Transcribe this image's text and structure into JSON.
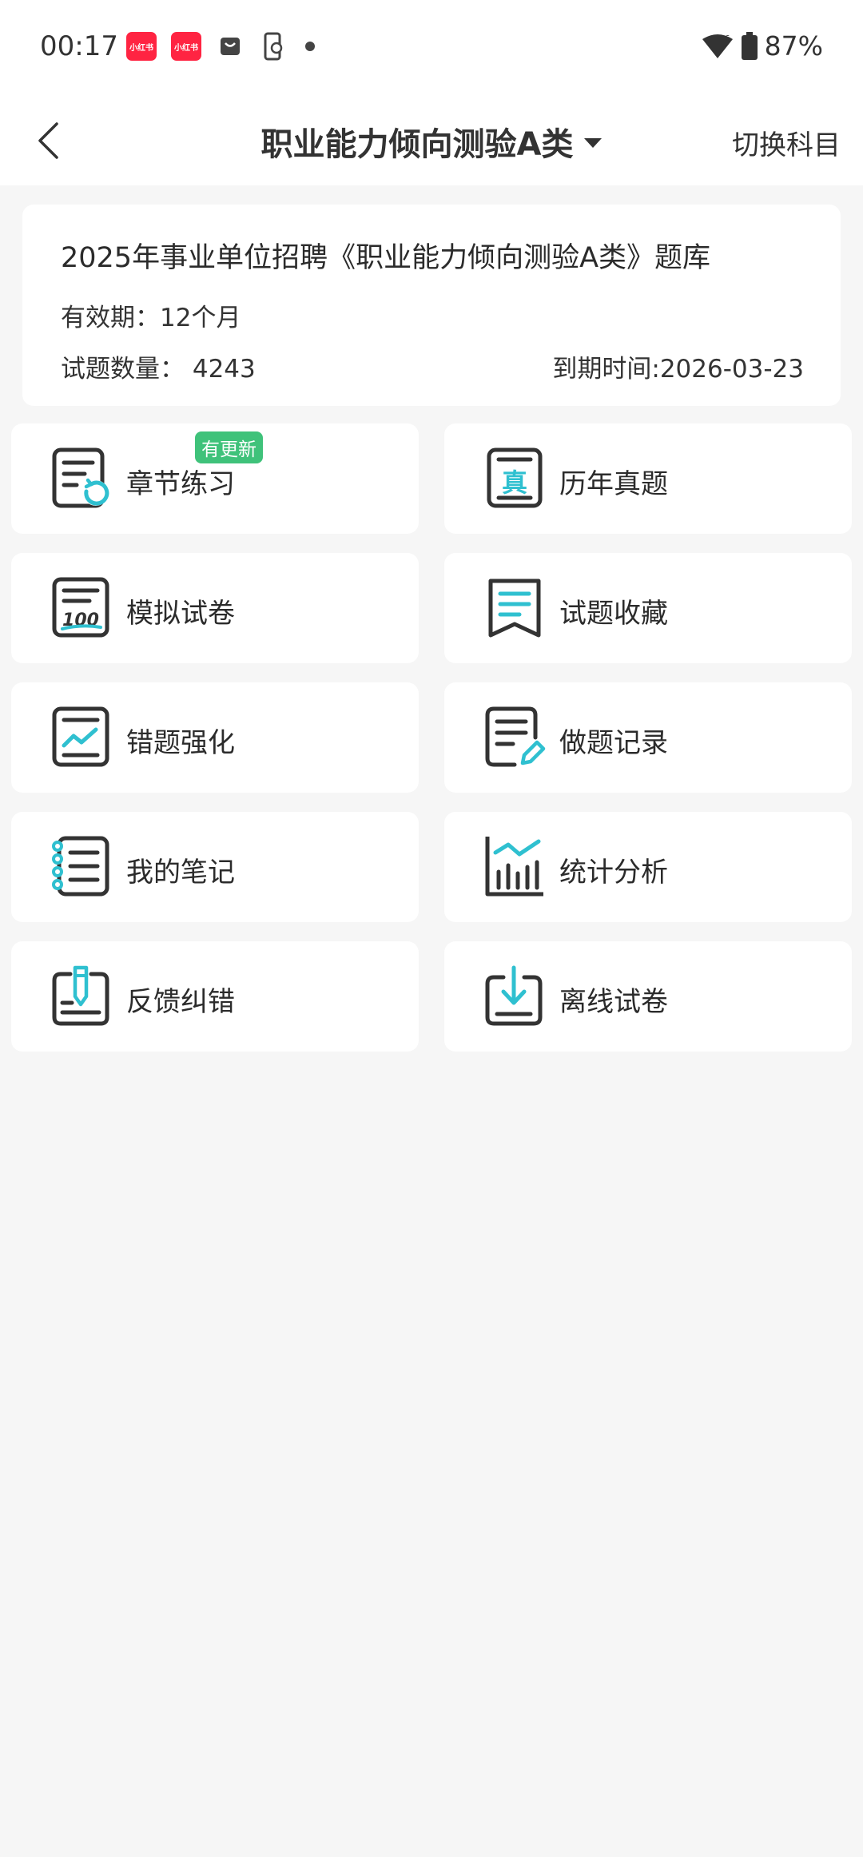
{
  "status_bar": {
    "time": "00:17",
    "xhs_label": "小红书",
    "battery": "87%",
    "colors": {
      "xhs": "#ff2442"
    }
  },
  "header": {
    "title": "职业能力倾向测验A类",
    "switch_label": "切换科目"
  },
  "info": {
    "title": "2025年事业单位招聘《职业能力倾向测验A类》题库",
    "validity": "有效期：12个月",
    "count": "试题数量：  4243",
    "expire": "到期时间:2026-03-23"
  },
  "tiles": [
    {
      "label": "章节练习",
      "icon": "chapter-practice-icon",
      "badge": "有更新"
    },
    {
      "label": "历年真题",
      "icon": "past-exam-icon"
    },
    {
      "label": "模拟试卷",
      "icon": "mock-exam-icon"
    },
    {
      "label": "试题收藏",
      "icon": "bookmark-icon"
    },
    {
      "label": "错题强化",
      "icon": "wrong-question-icon"
    },
    {
      "label": "做题记录",
      "icon": "record-icon"
    },
    {
      "label": "我的笔记",
      "icon": "notes-icon"
    },
    {
      "label": "统计分析",
      "icon": "statistics-icon"
    },
    {
      "label": "反馈纠错",
      "icon": "feedback-icon"
    },
    {
      "label": "离线试卷",
      "icon": "download-icon"
    }
  ],
  "colors": {
    "accent": "#2fc0d0",
    "icon_stroke": "#333333",
    "badge": "#3fc27a"
  }
}
